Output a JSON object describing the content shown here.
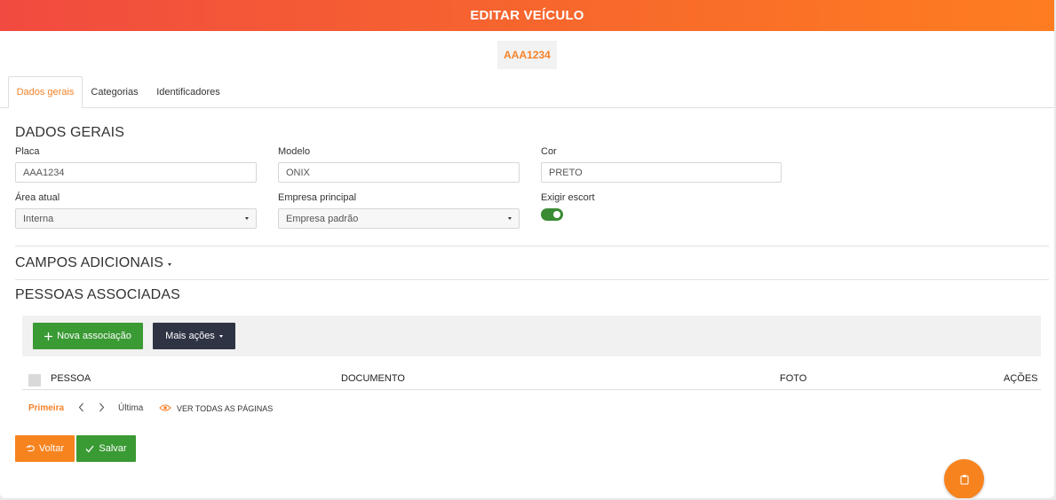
{
  "header": {
    "title": "EDITAR VEÍCULO"
  },
  "plate_badge": "AAA1234",
  "tabs": [
    {
      "label": "Dados gerais",
      "active": true
    },
    {
      "label": "Categorias",
      "active": false
    },
    {
      "label": "Identificadores",
      "active": false
    }
  ],
  "dados_gerais": {
    "title": "DADOS GERAIS",
    "placa": {
      "label": "Placa",
      "value": "AAA1234"
    },
    "modelo": {
      "label": "Modelo",
      "value": "ONIX"
    },
    "cor": {
      "label": "Cor",
      "value": "PRETO"
    },
    "area_atual": {
      "label": "Área atual",
      "value": "Interna"
    },
    "empresa_principal": {
      "label": "Empresa principal",
      "value": "Empresa padrão"
    },
    "exigir_escort": {
      "label": "Exigir escort",
      "enabled": true
    }
  },
  "campos_adicionais": {
    "title": "CAMPOS ADICIONAIS"
  },
  "pessoas_associadas": {
    "title": "PESSOAS ASSOCIADAS",
    "nova_associacao_label": "Nova associação",
    "mais_acoes_label": "Mais ações",
    "columns": [
      "PESSOA",
      "DOCUMENTO",
      "FOTO",
      "AÇÕES"
    ],
    "pagination": {
      "first": "Primeira",
      "last": "Última",
      "view_all": "VER TODAS AS PÁGINAS"
    }
  },
  "footer": {
    "voltar_label": "Voltar",
    "salvar_label": "Salvar"
  },
  "colors": {
    "accent": "#f5822a",
    "success": "#3a9a34",
    "dark": "#2f3445"
  }
}
